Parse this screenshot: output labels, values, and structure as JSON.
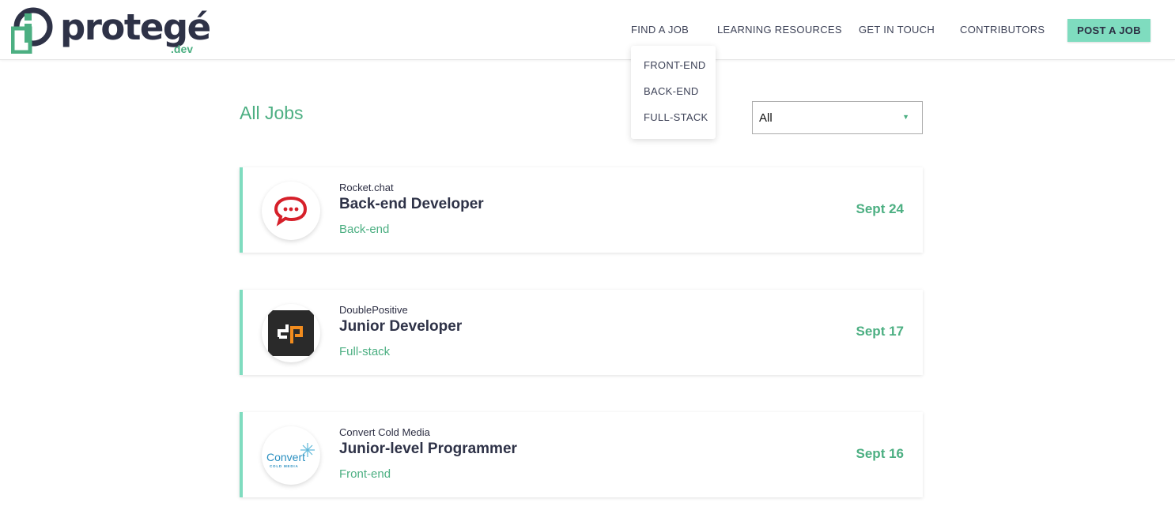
{
  "brand": {
    "name": "protegé",
    "suffix": ".dev",
    "accent_color": "#4caf82",
    "button_color": "#7fdcbf"
  },
  "nav": {
    "find_job": "FIND A JOB",
    "learning": "LEARNING RESOURCES",
    "contact": "GET IN TOUCH",
    "contributors": "CONTRIBUTORS",
    "post_job": "POST A JOB"
  },
  "dropdown": {
    "items": [
      "FRONT-END",
      "BACK-END",
      "FULL-STACK"
    ]
  },
  "main": {
    "title": "All Jobs",
    "filter": {
      "selected": "All",
      "arrow_icon": "triangle-down-icon"
    }
  },
  "jobs": [
    {
      "company": "Rocket.chat",
      "title": "Back-end Developer",
      "type": "Back-end",
      "date": "Sept 24",
      "logo": "rocketchat-logo"
    },
    {
      "company": "DoublePositive",
      "title": "Junior Developer",
      "type": "Full-stack",
      "date": "Sept 17",
      "logo": "doublepositive-logo"
    },
    {
      "company": "Convert Cold Media",
      "title": "Junior-level Programmer",
      "type": "Front-end",
      "date": "Sept 16",
      "logo": "convertcoldmedia-logo",
      "logo_text": "Convert",
      "logo_subtext": "COLD MEDIA"
    }
  ]
}
